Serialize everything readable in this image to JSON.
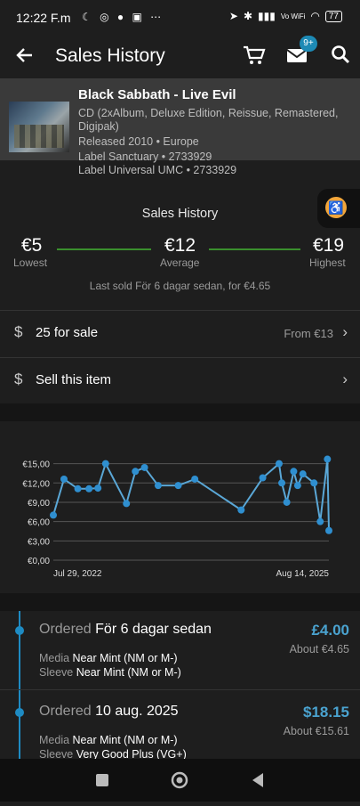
{
  "status_bar": {
    "time": "12:22 F.m",
    "battery": "77",
    "vowifi": "Vo WiFi"
  },
  "appbar": {
    "title": "Sales History",
    "badge": "9+"
  },
  "release": {
    "title": "Black Sabbath - Live Evil",
    "format": "CD (2xAlbum, Deluxe Edition, Reissue, Remastered, Digipak)",
    "released": "Released 2010 • Europe",
    "label1": "Label Sanctuary • 2733929",
    "label2": "Label Universal UMC • 2733929"
  },
  "summary": {
    "title": "Sales History",
    "lowest_value": "€5",
    "lowest_label": "Lowest",
    "average_value": "€12",
    "average_label": "Average",
    "highest_value": "€19",
    "highest_label": "Highest",
    "last_sold": "Last sold För 6 dagar sedan, for €4.65"
  },
  "for_sale": {
    "label": "25 for sale",
    "from": "From €13"
  },
  "sell": {
    "label": "Sell this item"
  },
  "chart_data": {
    "type": "line",
    "y_ticks": [
      "€0,00",
      "€3,00",
      "€6,00",
      "€9,00",
      "€12,00",
      "€15,00"
    ],
    "ylim": [
      0,
      15.5
    ],
    "x_start_label": "Jul 29, 2022",
    "x_end_label": "Aug 14, 2025",
    "x_range": [
      "2022-07-29",
      "2025-08-14"
    ],
    "grid": true,
    "points": [
      {
        "x": "2022-07-29",
        "y": 7.0
      },
      {
        "x": "2022-09-10",
        "y": 12.6
      },
      {
        "x": "2022-11-05",
        "y": 11.1
      },
      {
        "x": "2022-12-20",
        "y": 11.1
      },
      {
        "x": "2023-01-25",
        "y": 11.2
      },
      {
        "x": "2023-02-25",
        "y": 15.0
      },
      {
        "x": "2023-05-20",
        "y": 8.8
      },
      {
        "x": "2023-06-25",
        "y": 13.8
      },
      {
        "x": "2023-08-01",
        "y": 14.4
      },
      {
        "x": "2023-09-25",
        "y": 11.6
      },
      {
        "x": "2023-12-15",
        "y": 11.6
      },
      {
        "x": "2024-02-20",
        "y": 12.6
      },
      {
        "x": "2024-08-25",
        "y": 7.8
      },
      {
        "x": "2024-11-20",
        "y": 12.8
      },
      {
        "x": "2025-01-25",
        "y": 15.0
      },
      {
        "x": "2025-02-05",
        "y": 12.0
      },
      {
        "x": "2025-02-25",
        "y": 9.0
      },
      {
        "x": "2025-03-25",
        "y": 13.8
      },
      {
        "x": "2025-04-10",
        "y": 11.6
      },
      {
        "x": "2025-05-01",
        "y": 13.4
      },
      {
        "x": "2025-06-15",
        "y": 12.0
      },
      {
        "x": "2025-07-10",
        "y": 6.0
      },
      {
        "x": "2025-08-08",
        "y": 15.7
      },
      {
        "x": "2025-08-14",
        "y": 4.6
      }
    ]
  },
  "orders": [
    {
      "ordered_label": "Ordered",
      "date": "För 6 dagar sedan",
      "amount": "£4.00",
      "about": "About €4.65",
      "media_label": "Media",
      "media": "Near Mint (NM or M-)",
      "sleeve_label": "Sleeve",
      "sleeve": "Near Mint (NM or M-)"
    },
    {
      "ordered_label": "Ordered",
      "date": "10 aug. 2025",
      "amount": "$18.15",
      "about": "About €15.61",
      "media_label": "Media",
      "media": "Near Mint (NM or M-)",
      "sleeve_label": "Sleeve",
      "sleeve": "Very Good Plus (VG+)"
    }
  ],
  "colors": {
    "accent": "#1e8bc3",
    "price": "#4aa3d0",
    "average_line": "#3a8f2d",
    "fab": "#f2a63b"
  }
}
